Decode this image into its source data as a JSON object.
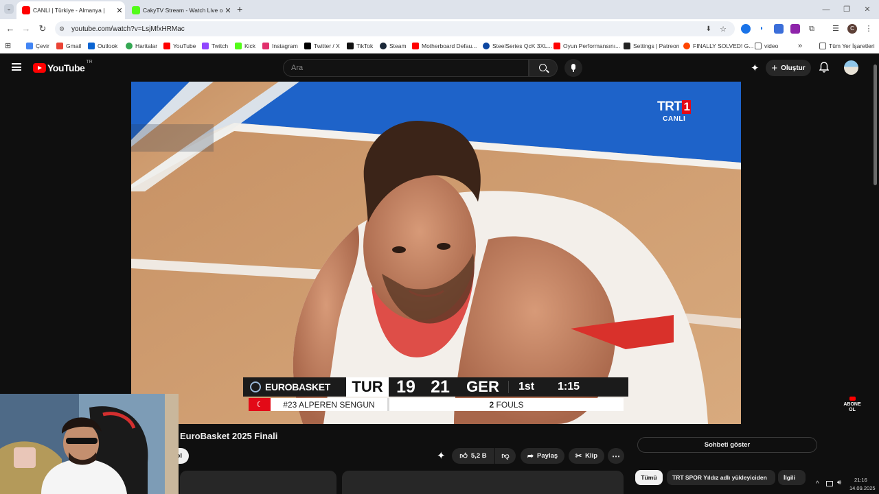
{
  "browser": {
    "tabs": [
      {
        "title": "CANLI | Türkiye - Almanya | ",
        "active": true
      },
      {
        "title": "CakyTV Stream - Watch Live or",
        "active": false
      }
    ],
    "new_tab_symbol": "+",
    "url": "youtube.com/watch?v=LsjMfxHRMac",
    "bookmarks": [
      {
        "label": "Çevir",
        "icon": "translate-icon",
        "color": "#4285f4"
      },
      {
        "label": "Gmail",
        "icon": "gmail-icon",
        "color": "#ea4335"
      },
      {
        "label": "Outlook",
        "icon": "outlook-icon",
        "color": "#0a64d2"
      },
      {
        "label": "Haritalar",
        "icon": "maps-icon",
        "color": "#34a853"
      },
      {
        "label": "YouTube",
        "icon": "youtube-icon",
        "color": "#ff0000"
      },
      {
        "label": "Twitch",
        "icon": "twitch-icon",
        "color": "#9146ff"
      },
      {
        "label": "Kick",
        "icon": "kick-icon",
        "color": "#53fc18"
      },
      {
        "label": "Instagram",
        "icon": "instagram-icon",
        "color": "#e1306c"
      },
      {
        "label": "Twitter / X",
        "icon": "x-icon",
        "color": "#000000"
      },
      {
        "label": "TikTok",
        "icon": "tiktok-icon",
        "color": "#111111"
      },
      {
        "label": "Steam",
        "icon": "steam-icon",
        "color": "#1b2838"
      },
      {
        "label": "Motherboard Defau...",
        "icon": "youtube-icon",
        "color": "#ff0000"
      },
      {
        "label": "SteelSeries QcK 3XL...",
        "icon": "steelseries-icon",
        "color": "#0d47a1"
      },
      {
        "label": "Oyun Performansını...",
        "icon": "youtube-icon",
        "color": "#ff0000"
      },
      {
        "label": "Settings | Patreon",
        "icon": "patreon-icon",
        "color": "#222222"
      },
      {
        "label": "FINALLY SOLVED! G...",
        "icon": "reddit-icon",
        "color": "#ff4500"
      },
      {
        "label": "video",
        "icon": "folder-icon",
        "color": "#555555"
      }
    ],
    "overflow_symbol": "»",
    "all_bookmarks_label": "Tüm Yer İşaretleri"
  },
  "youtube": {
    "logo_text": "YouTube",
    "region": "TR",
    "search_placeholder": "Ara",
    "create_label": "Oluştur",
    "video_title": "EuroBasket 2025 Finali",
    "partial_button": "ol",
    "likes": "5,2 B",
    "share_label": "Paylaş",
    "clip_label": "Klip",
    "show_chat_label": "Sohbeti göster",
    "chip_partial": "Tümü",
    "chip_text": "TRT SPOR Yıldız adlı yükleyiciden",
    "chip_partial2": "İlgili",
    "subscribe_watermark": [
      "ABONE",
      "OL"
    ],
    "accent": "#ff0000"
  },
  "broadcast": {
    "channel": "TRT 1",
    "channel_logo_text": "TRT",
    "channel_logo_number": "1",
    "live_text": "CANLI",
    "competition": "EUROBASKET",
    "home_team": "TUR",
    "home_score": "19",
    "away_score": "21",
    "away_team": "GER",
    "period": "1st",
    "clock": "1:15",
    "player_caption": "#23 ALPEREN SENGUN",
    "fouls_count": "2",
    "fouls_label": "FOULS"
  },
  "tray": {
    "time": "21:16",
    "date": "14.09.2025",
    "expand_symbol": "^"
  }
}
